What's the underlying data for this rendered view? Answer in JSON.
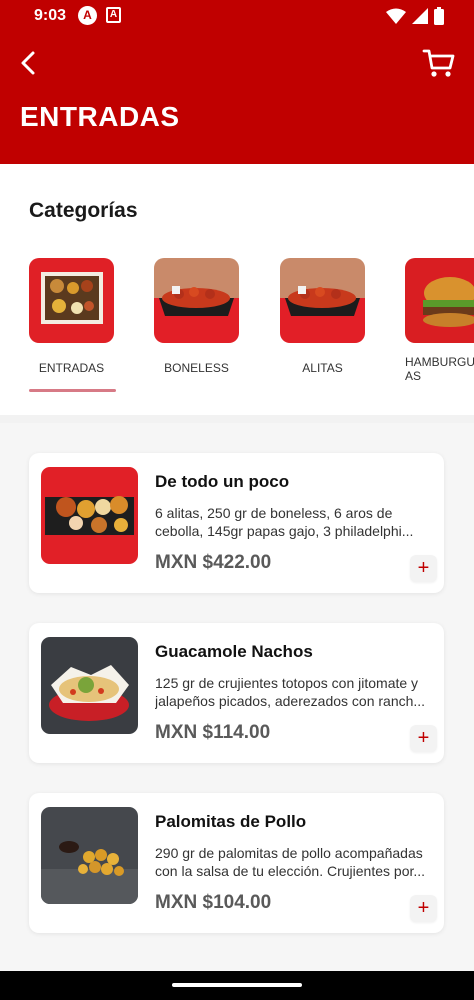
{
  "status_bar": {
    "time": "9:03",
    "notif_a": "A",
    "notif_b": "A"
  },
  "header": {
    "title": "ENTRADAS"
  },
  "categories": {
    "title": "Categorías",
    "items": [
      {
        "label": "ENTRADAS",
        "selected": true
      },
      {
        "label": "BONELESS"
      },
      {
        "label": "ALITAS"
      },
      {
        "label": "HAMBURGUESAS",
        "label_visible": "HAMBURGU AS"
      }
    ]
  },
  "products": [
    {
      "name": "De todo un poco",
      "description": "6 alitas, 250 gr de boneless, 6 aros de cebolla, 145gr papas gajo, 3 philadelphi...",
      "price": "MXN $422.00",
      "add_label": "+"
    },
    {
      "name": "Guacamole Nachos",
      "description": "125 gr de crujientes totopos con jitomate y jalapeños picados, aderezados con ranch...",
      "price": "MXN $114.00",
      "add_label": "+"
    },
    {
      "name": "Palomitas de Pollo",
      "description": "290 gr de palomitas de pollo acompañadas con la salsa de tu elección. Crujientes por...",
      "price": "MXN $104.00",
      "add_label": "+"
    }
  ],
  "colors": {
    "brand_red": "#c00000",
    "selected_underline": "#d77a86"
  }
}
